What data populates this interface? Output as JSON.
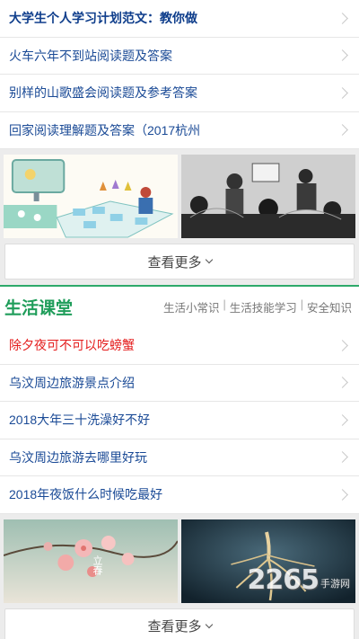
{
  "list1": [
    {
      "title": "大学生个人学习计划范文：教你做"
    },
    {
      "title": "火车六年不到站阅读题及答案"
    },
    {
      "title": "别样的山歌盛会阅读题及参考答案"
    },
    {
      "title": "回家阅读理解题及答案（2017杭州"
    }
  ],
  "more_label": "查看更多",
  "section": {
    "title": "生活课堂",
    "links": [
      "生活小常识",
      "生活技能学习",
      "安全知识"
    ],
    "separator": "|"
  },
  "list2": [
    {
      "title": "除夕夜可不可以吃螃蟹"
    },
    {
      "title": "乌汶周边旅游景点介绍"
    },
    {
      "title": "2018大年三十洗澡好不好"
    },
    {
      "title": "乌汶周边旅游去哪里好玩"
    },
    {
      "title": "2018年夜饭什么时候吃最好"
    }
  ],
  "images2": {
    "left_caption": "立春"
  },
  "watermark": {
    "brand": "2265",
    "site": "手游网"
  },
  "colors": {
    "accent_green": "#1f9d5a",
    "link_blue": "#1a4a96",
    "hot_red": "#e41c1c"
  }
}
